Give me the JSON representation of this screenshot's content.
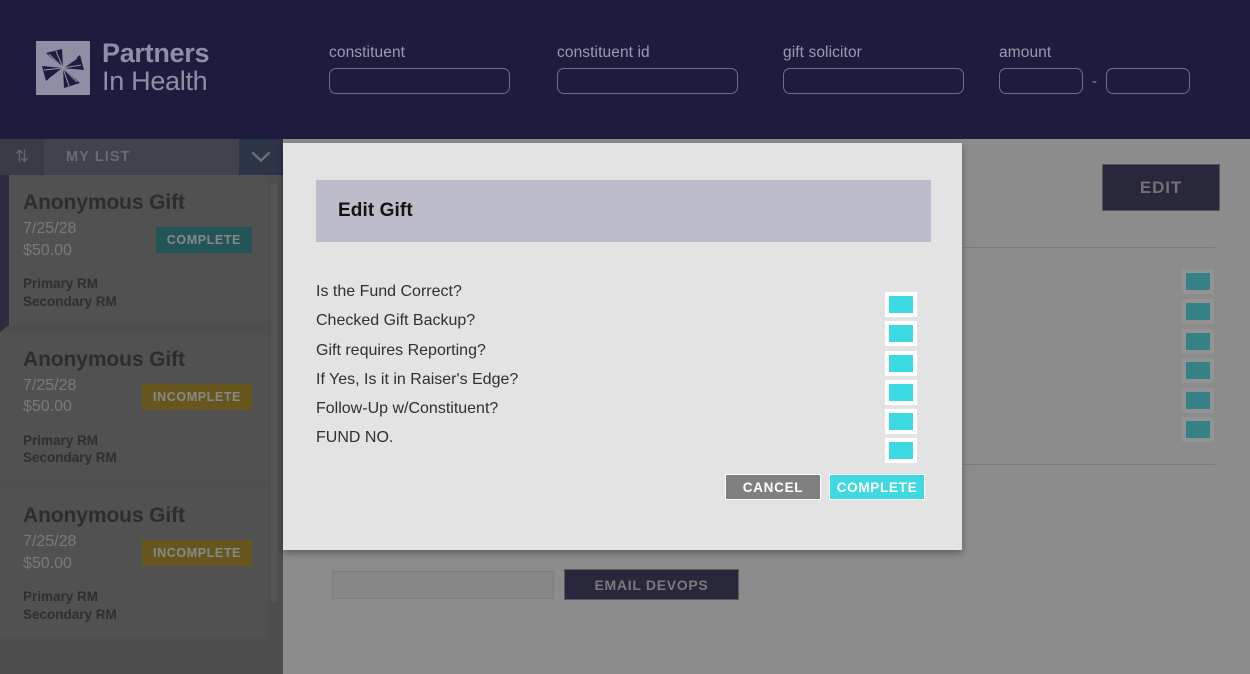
{
  "brand": {
    "line1": "Partners",
    "line2": "In Health",
    "logo_icon": "pinwheel-logo-icon"
  },
  "filters": [
    {
      "label": "constituent",
      "value": "",
      "placeholder": ""
    },
    {
      "label": "constituent id",
      "value": "",
      "placeholder": ""
    },
    {
      "label": "gift solicitor",
      "value": "",
      "placeholder": ""
    }
  ],
  "amount_filter": {
    "label": "amount",
    "min_value": "",
    "max_value": "",
    "separator": "-"
  },
  "sidebar": {
    "sort_icon": "⇅",
    "list_name": "MY LIST",
    "caret_icon": "chevron-down-icon",
    "cards": [
      {
        "title": "Anonymous Gift",
        "date": "7/25/28",
        "amount": "$50.00",
        "status": "COMPLETE",
        "status_kind": "complete",
        "primary_rm": "Primary RM",
        "secondary_rm": "Secondary RM"
      },
      {
        "title": "Anonymous Gift",
        "date": "7/25/28",
        "amount": "$50.00",
        "status": "INCOMPLETE",
        "status_kind": "incomplete",
        "primary_rm": "Primary RM",
        "secondary_rm": "Secondary RM"
      },
      {
        "title": "Anonymous Gift",
        "date": "7/25/28",
        "amount": "$50.00",
        "status": "INCOMPLETE",
        "status_kind": "incomplete",
        "primary_rm": "Primary RM",
        "secondary_rm": "Secondary RM"
      }
    ]
  },
  "main": {
    "edit_label": "EDIT",
    "devops_button_label": "EMAIL DEVOPS",
    "devops_input_value": "",
    "background_checkbox_count": 6
  },
  "modal": {
    "title": "Edit Gift",
    "rows": [
      {
        "label": "Is the Fund Correct?",
        "checked": true
      },
      {
        "label": "Checked Gift Backup?",
        "checked": true
      },
      {
        "label": "Gift requires Reporting?",
        "checked": true
      },
      {
        "label": "If Yes, Is it in Raiser's Edge?",
        "checked": true
      },
      {
        "label": "Follow-Up w/Constituent?",
        "checked": true
      },
      {
        "label": "FUND NO.",
        "checked": true
      }
    ],
    "cancel_label": "CANCEL",
    "complete_label": "COMPLETE"
  },
  "colors": {
    "navy": "#1d1c3f",
    "cyan": "#3bd9e2",
    "teal": "#147d85",
    "gold": "#a3830c",
    "overlay_grey": "#6f6f6f"
  }
}
